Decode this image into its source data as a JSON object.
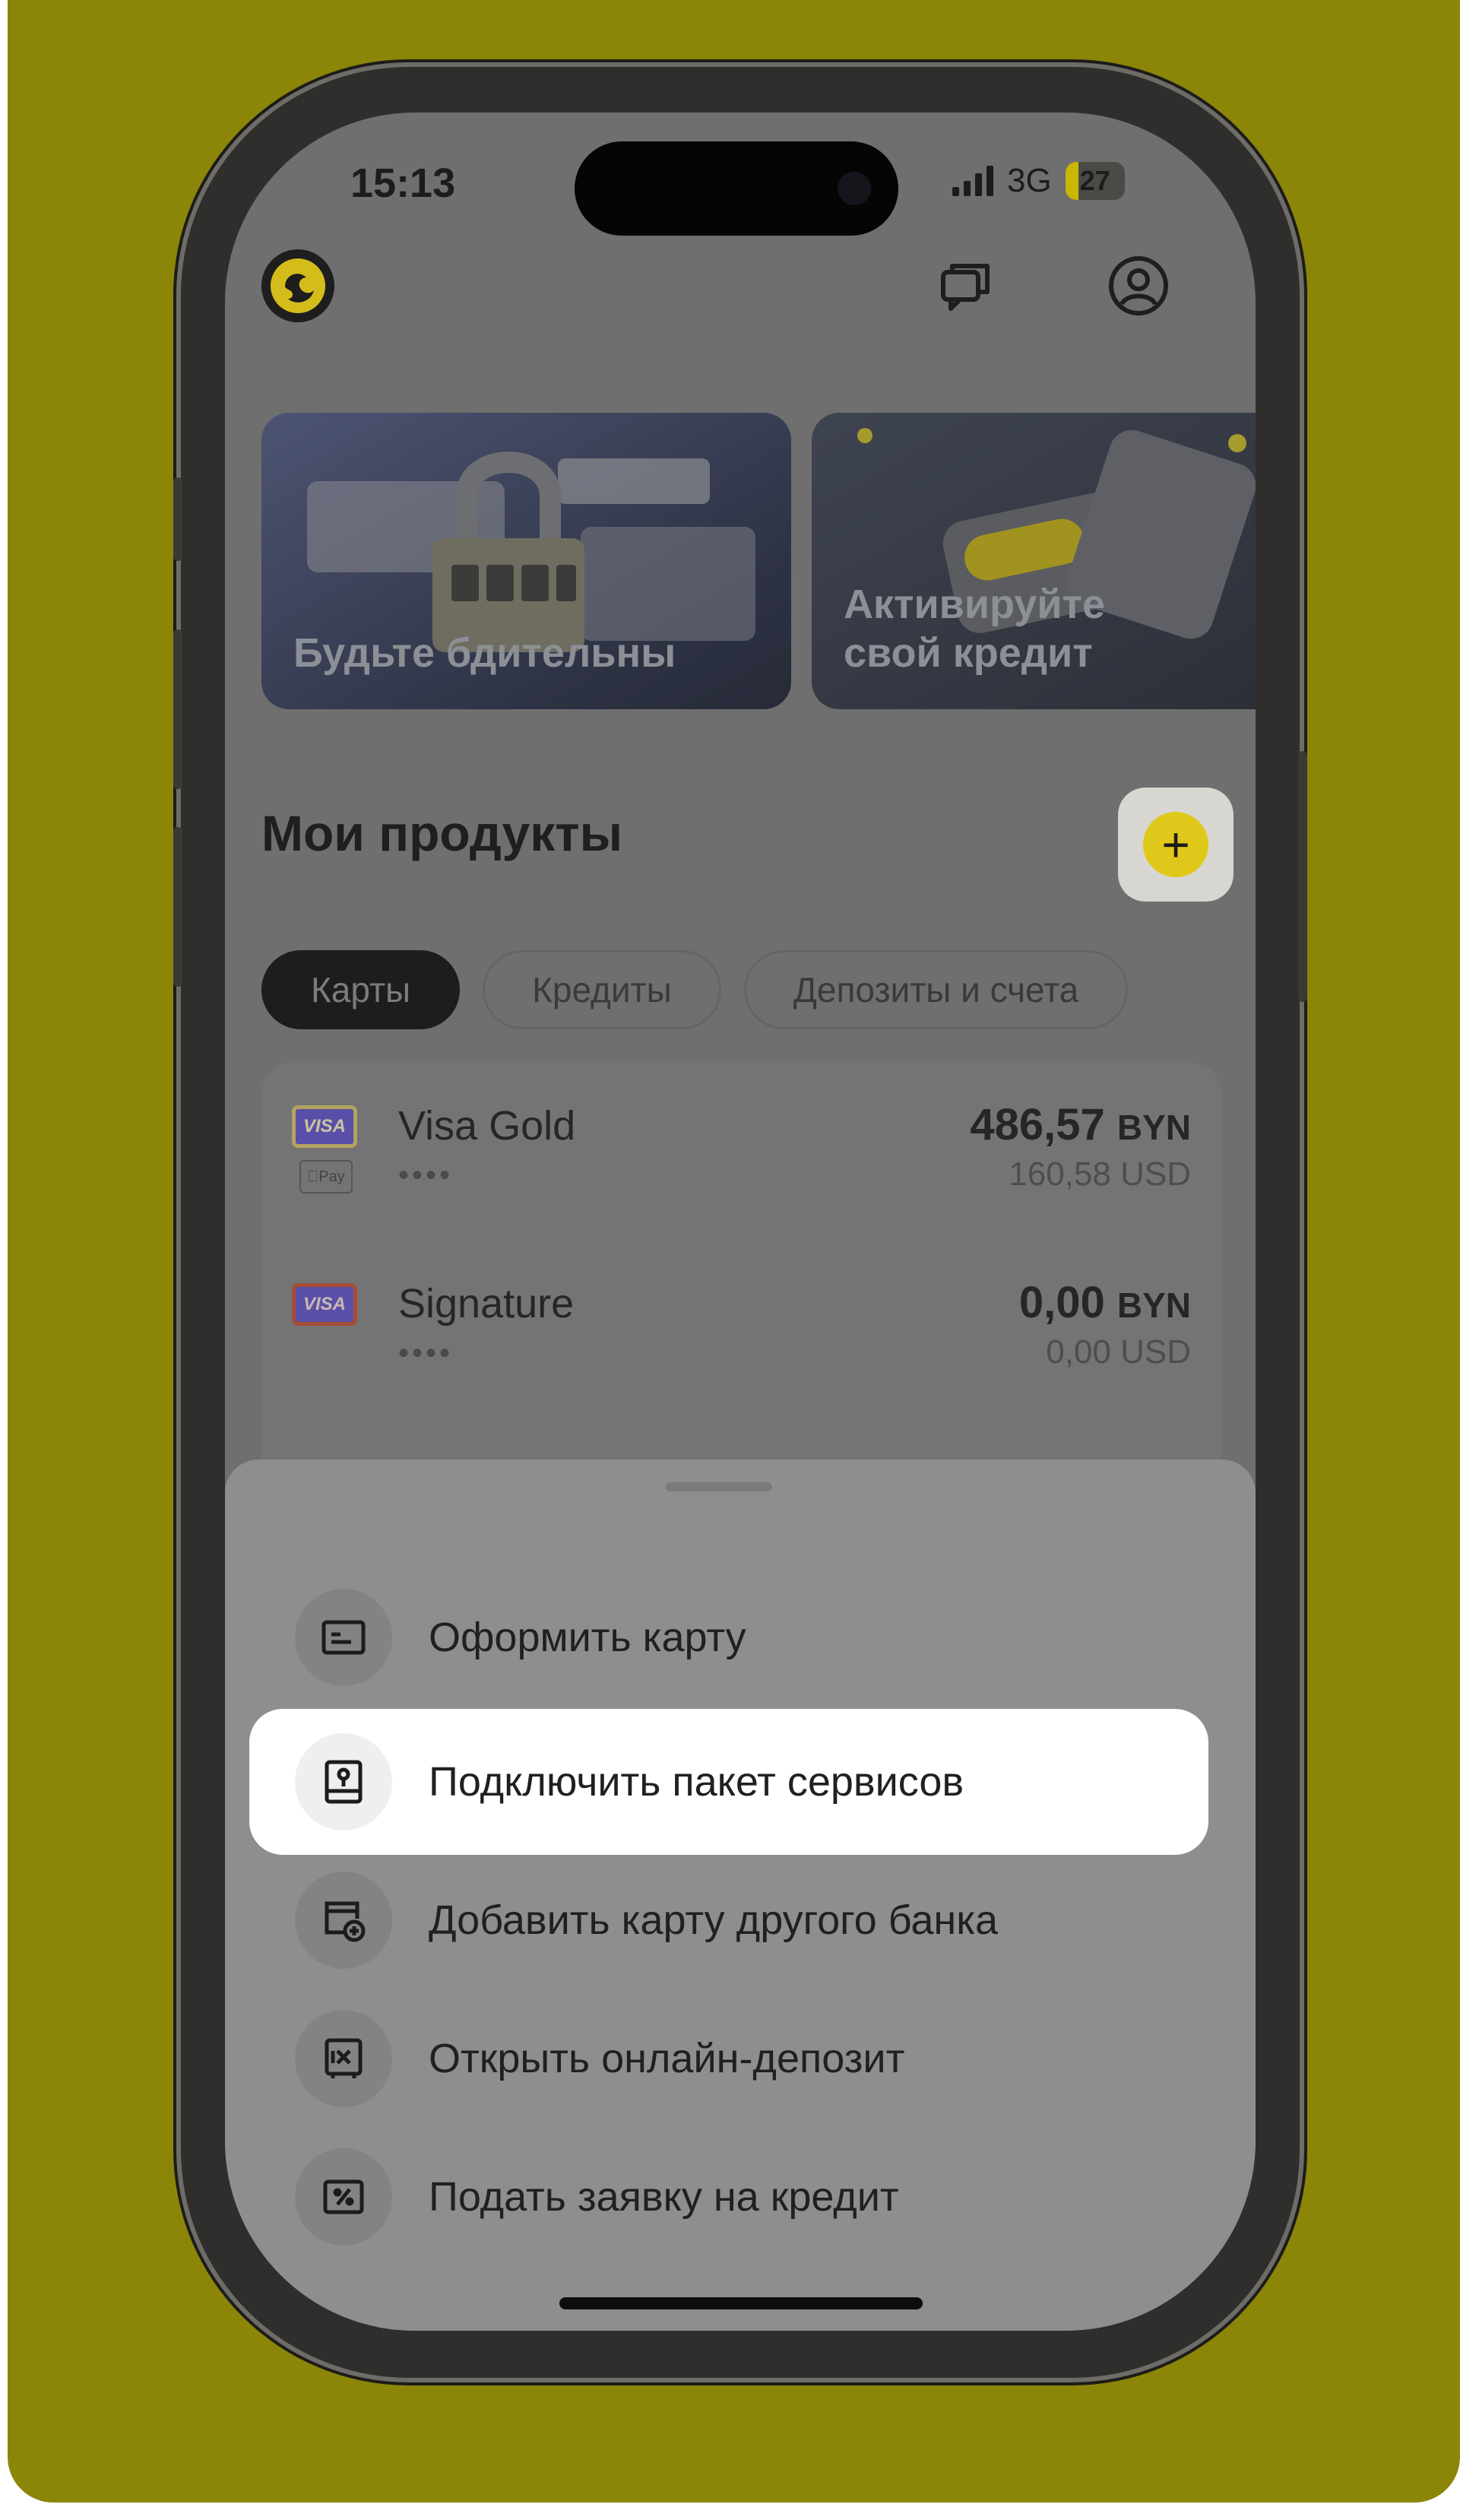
{
  "status_bar": {
    "time": "15:13",
    "network": "3G",
    "battery": "27"
  },
  "header": {
    "logo_icon": "bank-logo-icon",
    "chat_icon": "chat-icon",
    "profile_icon": "profile-icon"
  },
  "banners": [
    {
      "title_line1": "Будьте бдительны",
      "title_line2": ""
    },
    {
      "title_line1": "Активируйте",
      "title_line2": "свой кредит"
    }
  ],
  "products": {
    "title": "Мои продукты",
    "add_label": "+",
    "tabs": [
      {
        "label": "Карты",
        "active": true
      },
      {
        "label": "Кредиты",
        "active": false
      },
      {
        "label": "Депозиты и счета",
        "active": false
      }
    ],
    "cards": [
      {
        "brand": "VISA",
        "name": "Visa Gold",
        "mask": "••••",
        "amount": "486,57",
        "currency": "BYN",
        "usd": "160,58 USD",
        "wallet": "Pay",
        "brand_color": "#b3a360"
      },
      {
        "brand": "VISA",
        "name": "Signature",
        "mask": "••••",
        "amount": "0,00",
        "currency": "BYN",
        "usd": "0,00 USD",
        "wallet": "",
        "brand_color": "#a54d36"
      }
    ]
  },
  "sheet": {
    "items": [
      {
        "label": "Оформить карту",
        "icon": "card-icon",
        "highlight": false
      },
      {
        "label": "Подключить пакет сервисов",
        "icon": "service-package-icon",
        "highlight": true
      },
      {
        "label": "Добавить карту другого банка",
        "icon": "add-card-icon",
        "highlight": false
      },
      {
        "label": "Открыть онлайн-депозит",
        "icon": "deposit-safe-icon",
        "highlight": false
      },
      {
        "label": "Подать заявку на кредит",
        "icon": "credit-percent-icon",
        "highlight": false
      }
    ]
  },
  "colors": {
    "background": "#8b8608",
    "accent": "#e0c81a",
    "highlight": "#ffffff"
  }
}
